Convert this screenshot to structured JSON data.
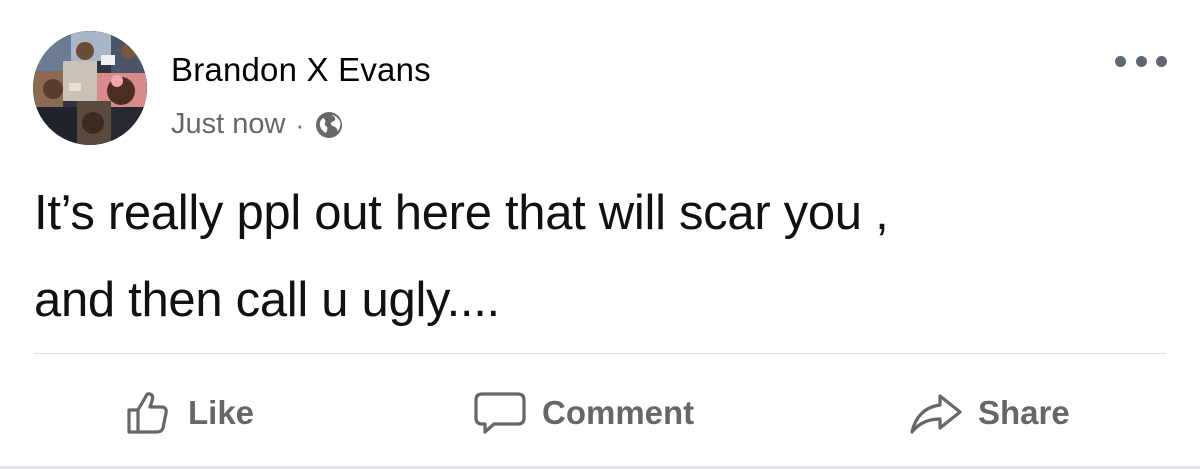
{
  "post": {
    "author": "Brandon X Evans",
    "timestamp": "Just now",
    "separator": "·",
    "audience_icon": "globe-icon",
    "text": "It’s really ppl out here that will scar you ,\nand then call u ugly....",
    "more_icon": "more-dots-icon"
  },
  "actions": {
    "like_label": "Like",
    "like_icon": "thumbs-up-icon",
    "comment_label": "Comment",
    "comment_icon": "comment-bubble-icon",
    "share_label": "Share",
    "share_icon": "share-arrow-icon"
  },
  "colors": {
    "primary_text": "#050505",
    "secondary_text": "#65676b",
    "divider": "#dadde1"
  }
}
